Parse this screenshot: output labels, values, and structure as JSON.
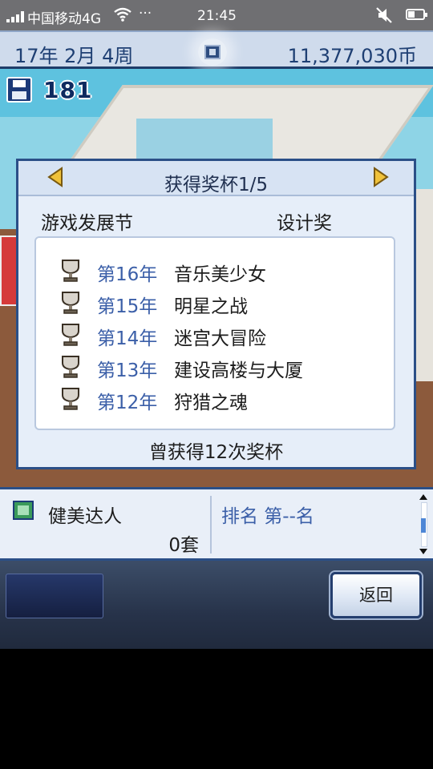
{
  "status_bar": {
    "carrier": "中国移动4G",
    "more": "···",
    "time": "21:45"
  },
  "header": {
    "date": "17年 2月 4周",
    "money": "11,377,030币"
  },
  "save": {
    "count": "181"
  },
  "trophy_dialog": {
    "title": "获得奖杯1/5",
    "event": "游戏发展节",
    "award": "设计奖",
    "entries": [
      {
        "year": "第16年",
        "game": "音乐美少女"
      },
      {
        "year": "第15年",
        "game": "明星之战"
      },
      {
        "year": "第14年",
        "game": "迷宫大冒险"
      },
      {
        "year": "第13年",
        "game": "建设高楼与大厦"
      },
      {
        "year": "第12年",
        "game": "狩猎之魂"
      }
    ],
    "total": "曾获得12次奖杯"
  },
  "info_panel": {
    "genre": "健美达人",
    "count": "0套",
    "rank": "排名 第--名"
  },
  "controls": {
    "back_label": "返回"
  },
  "colors": {
    "accent_blue": "#3b5fa8",
    "frame_blue": "#2b4f87",
    "dialog_bg": "#e6eef9"
  }
}
